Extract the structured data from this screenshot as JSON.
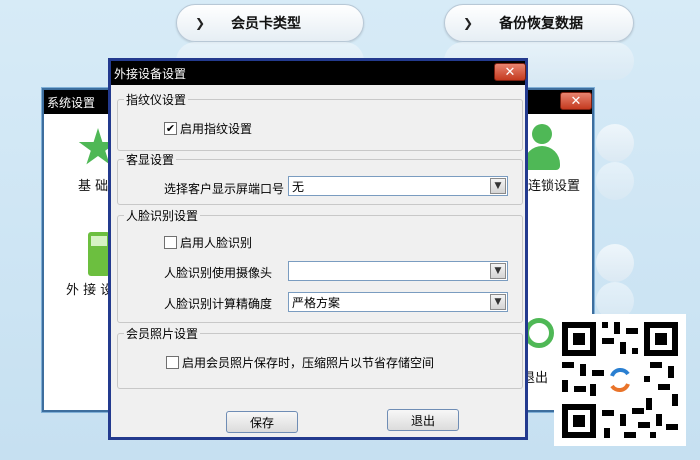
{
  "bg_buttons": {
    "member_card_type": "会员卡类型",
    "backup_restore": "备份恢复数据"
  },
  "back_window": {
    "title": "系统设置",
    "close_glyph": "✕",
    "basic_label": "基 础",
    "external_label": "外 接 设",
    "lock_label": "连锁设置",
    "exit_label": "退出"
  },
  "dialog": {
    "title": "外接设备设置",
    "close_glyph": "✕",
    "fingerprint": {
      "group_title": "指纹仪设置",
      "enable_label": "启用指纹设置",
      "enable_checked": true
    },
    "customer_display": {
      "group_title": "客显设置",
      "port_label": "选择客户显示屏端口号",
      "port_value": "无"
    },
    "face": {
      "group_title": "人脸识别设置",
      "enable_label": "启用人脸识别",
      "enable_checked": false,
      "camera_label": "人脸识别使用摄像头",
      "camera_value": "",
      "precision_label": "人脸识别计算精确度",
      "precision_value": "严格方案"
    },
    "photo": {
      "group_title": "会员照片设置",
      "compress_label": "启用会员照片保存时，压缩照片以节省存储空间",
      "compress_checked": false
    },
    "save_label": "保存",
    "exit_label": "退出"
  }
}
